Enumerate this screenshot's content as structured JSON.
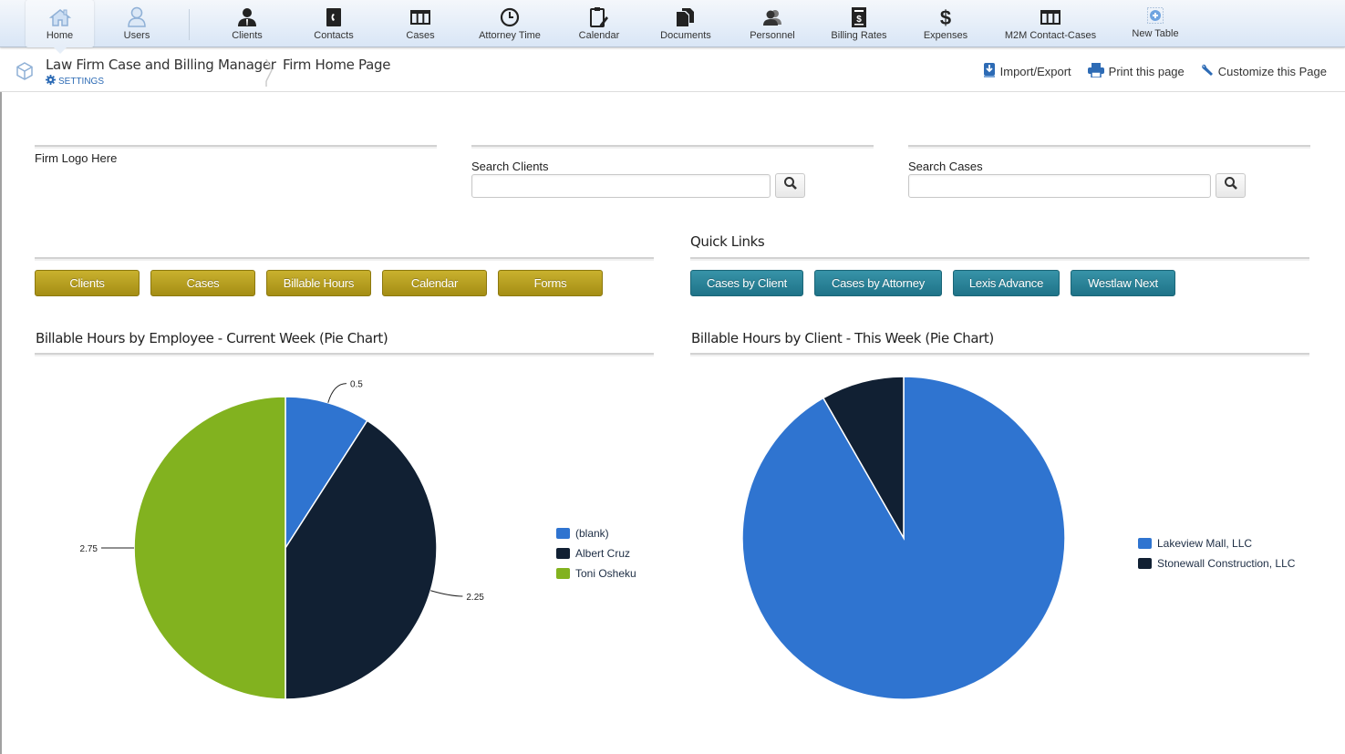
{
  "nav": {
    "items": [
      {
        "label": "Home",
        "icon": "home-icon",
        "active": true
      },
      {
        "label": "Users",
        "icon": "user-icon"
      },
      {
        "label": "Clients",
        "icon": "client-icon"
      },
      {
        "label": "Contacts",
        "icon": "contact-book-icon"
      },
      {
        "label": "Cases",
        "icon": "table-icon"
      },
      {
        "label": "Attorney Time",
        "icon": "clock-icon"
      },
      {
        "label": "Calendar",
        "icon": "clipboard-pencil-icon"
      },
      {
        "label": "Documents",
        "icon": "documents-icon"
      },
      {
        "label": "Personnel",
        "icon": "people-icon"
      },
      {
        "label": "Billing Rates",
        "icon": "billing-icon"
      },
      {
        "label": "Expenses",
        "icon": "dollar-icon"
      },
      {
        "label": "M2M Contact-Cases",
        "icon": "table-icon"
      },
      {
        "label": "New Table",
        "icon": "plus-circle-icon"
      }
    ]
  },
  "header": {
    "app_title": "Law Firm Case and Billing Manager",
    "settings_label": "SETTINGS",
    "page_title": "Firm Home Page",
    "actions": {
      "import_export": "Import/Export",
      "print": "Print this page",
      "customize": "Customize this Page"
    }
  },
  "main": {
    "logo_placeholder": "Firm Logo Here",
    "search_clients": {
      "label": "Search Clients",
      "value": "",
      "placeholder": ""
    },
    "search_cases": {
      "label": "Search Cases",
      "value": "",
      "placeholder": ""
    },
    "nav_buttons": [
      "Clients",
      "Cases",
      "Billable Hours",
      "Calendar",
      "Forms"
    ],
    "quick_links": {
      "title": "Quick Links",
      "buttons": [
        "Cases by Client",
        "Cases by Attorney",
        "Lexis Advance",
        "Westlaw Next"
      ]
    },
    "colors": {
      "gold_button": "#b49e1f",
      "teal_button": "#2b8398"
    }
  },
  "chart_data": [
    {
      "type": "pie",
      "title": "Billable Hours by Employee - Current Week (Pie Chart)",
      "categories": [
        "(blank)",
        "Albert Cruz",
        "Toni Osheku"
      ],
      "values": [
        0.5,
        2.25,
        2.75
      ],
      "data_labels": [
        "0.5",
        "2.25",
        "2.75"
      ],
      "colors": [
        "#2f74d0",
        "#112033",
        "#82b21f"
      ],
      "legend": "right"
    },
    {
      "type": "pie",
      "title": "Billable Hours by Client - This Week (Pie Chart)",
      "categories": [
        "Lakeview Mall, LLC",
        "Stonewall Construction, LLC"
      ],
      "values": [
        0.917,
        0.083
      ],
      "value_unit": "fraction of total",
      "data_labels": [],
      "colors": [
        "#2f74d0",
        "#112033"
      ],
      "legend": "right"
    }
  ]
}
